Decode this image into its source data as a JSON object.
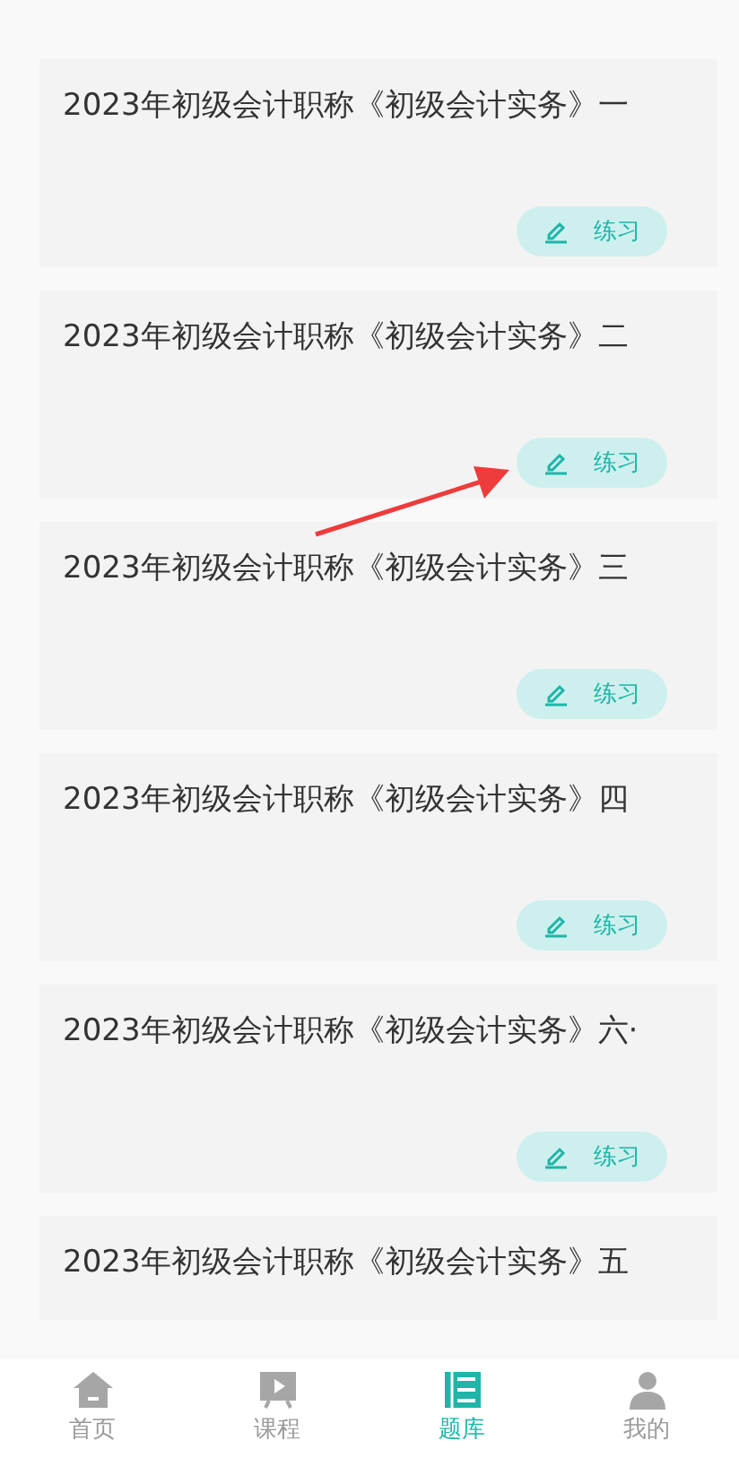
{
  "cards": [
    {
      "title": "2023年初级会计职称《初级会计实务》一",
      "action": "练习",
      "arrow": false
    },
    {
      "title": "2023年初级会计职称《初级会计实务》二",
      "action": "练习",
      "arrow": true
    },
    {
      "title": "2023年初级会计职称《初级会计实务》三",
      "action": "练习",
      "arrow": false
    },
    {
      "title": "2023年初级会计职称《初级会计实务》四",
      "action": "练习",
      "arrow": false
    },
    {
      "title": "2023年初级会计职称《初级会计实务》六·",
      "action": "练习",
      "arrow": false
    },
    {
      "title": "2023年初级会计职称《初级会计实务》五",
      "arrow": false
    }
  ],
  "tab_bar": [
    {
      "label": "首页",
      "kind": "home",
      "selected": false
    },
    {
      "label": "课程",
      "kind": "course",
      "selected": false
    },
    {
      "label": "题库",
      "kind": "bank",
      "selected": true
    },
    {
      "label": "我的",
      "kind": "profile",
      "selected": false
    }
  ]
}
